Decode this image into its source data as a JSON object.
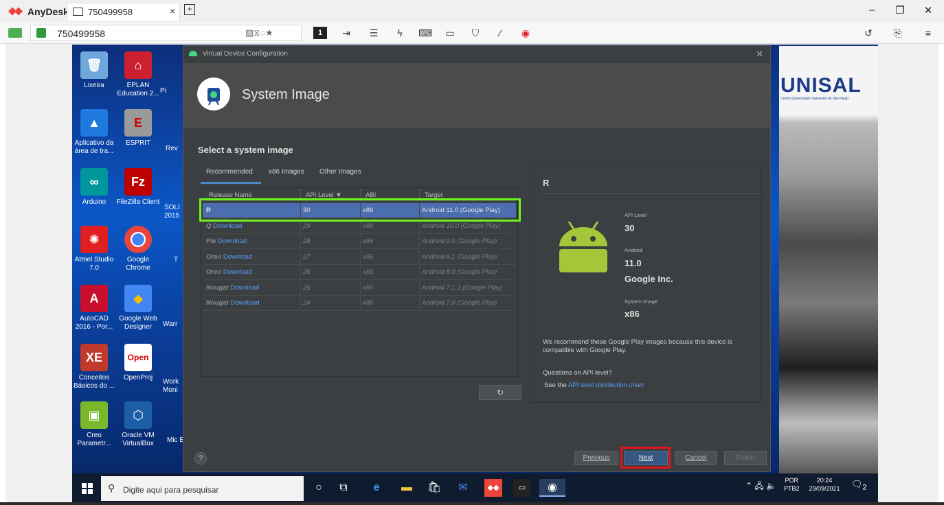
{
  "anydesk": {
    "app_name": "AnyDesk",
    "tab_label": "750499958",
    "address": "750499958",
    "brand_color": "#ef443b"
  },
  "desktop": {
    "icons": [
      {
        "label": "Lixeira",
        "color": "#6fa8dc"
      },
      {
        "label": "EPLAN Education 2...",
        "color": "#cc1f2f"
      },
      {
        "label": "Aplicativo da área de tra...",
        "color": "#1f7ae0"
      },
      {
        "label": "ESPRIT",
        "color": "#9a9a9a"
      },
      {
        "label": "Arduino",
        "color": "#00979c"
      },
      {
        "label": "FileZilla Client",
        "color": "#bf0000"
      },
      {
        "label": "Atmel Studio 7.0",
        "color": "#e02020"
      },
      {
        "label": "Google Chrome",
        "color": "#e8453c"
      },
      {
        "label": "AutoCAD 2016 - Por...",
        "color": "#c8102e"
      },
      {
        "label": "Google Web Designer",
        "color": "#4285f4"
      },
      {
        "label": "Conceitos Básicos do ...",
        "color": "#c0392b"
      },
      {
        "label": "OpenProj",
        "color": "#ffffff"
      },
      {
        "label": "Creo Parametr...",
        "color": "#79b929"
      },
      {
        "label": "Oracle VM VirtualBox",
        "color": "#1d5fa7"
      }
    ],
    "partial_labels": [
      "Pi",
      "Rev",
      "SOLI 2015",
      "T",
      "Warr",
      "Work Moni",
      "Mic E"
    ],
    "photo_text": "UNISAL",
    "photo_subtext": "Centro Universitário Salesiano de São Paulo"
  },
  "dialog": {
    "window_title": "Virtual Device Configuration",
    "header_title": "System Image",
    "section_title": "Select a system image",
    "tabs": [
      "Recommended",
      "x86 Images",
      "Other Images"
    ],
    "active_tab": "Recommended",
    "columns": [
      "Release Name",
      "API Level ▼",
      "ABI",
      "Target"
    ],
    "rows": [
      {
        "name": "R",
        "download": "",
        "api": "30",
        "abi": "x86",
        "target": "Android 11.0 (Google Play)",
        "selected": true
      },
      {
        "name": "Q",
        "download": "Download",
        "api": "29",
        "abi": "x86",
        "target": "Android 10.0 (Google Play)"
      },
      {
        "name": "Pie",
        "download": "Download",
        "api": "28",
        "abi": "x86",
        "target": "Android 9.0 (Google Play)"
      },
      {
        "name": "Oreo",
        "download": "Download",
        "api": "27",
        "abi": "x86",
        "target": "Android 8.1 (Google Play)"
      },
      {
        "name": "Oreo",
        "download": "Download",
        "api": "26",
        "abi": "x86",
        "target": "Android 8.0 (Google Play)"
      },
      {
        "name": "Nougat",
        "download": "Download",
        "api": "25",
        "abi": "x86",
        "target": "Android 7.1.1 (Google Play)"
      },
      {
        "name": "Nougat",
        "download": "Download",
        "api": "24",
        "abi": "x86",
        "target": "Android 7.0 (Google Play)"
      }
    ],
    "refresh_icon": "refresh-icon",
    "detail": {
      "name": "R",
      "api_label": "API Level",
      "api_value": "30",
      "android_label": "Android",
      "android_value": "11.0",
      "vendor": "Google Inc.",
      "sysimg_label": "System Image",
      "sysimg_value": "x86",
      "recommend_text": "We recommend these Google Play images because this device is compatible with Google Play.",
      "question": "Questions on API level?",
      "see_prefix": "See the ",
      "see_link": "API level distribution chart"
    },
    "help_label": "?",
    "buttons": {
      "previous": "Previous",
      "next": "Next",
      "cancel": "Cancel",
      "finish": "Finish"
    }
  },
  "taskbar": {
    "search_placeholder": "Digite aqui para pesquisar",
    "lang_top": "POR",
    "lang_bottom": "PTB2",
    "time": "20:24",
    "date": "29/09/2021",
    "notifications": "2"
  }
}
